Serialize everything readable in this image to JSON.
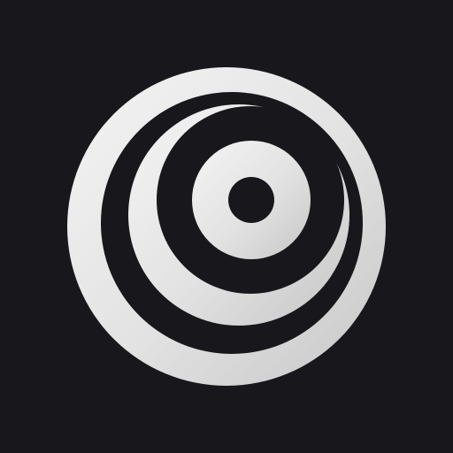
{
  "icon": {
    "name": "concentric-rings-logo-icon",
    "colors": {
      "background": "#18181c",
      "ring_light": "#f2f2f2",
      "ring_mid": "#dedede",
      "ring_dark": "#c4c4c4"
    }
  }
}
